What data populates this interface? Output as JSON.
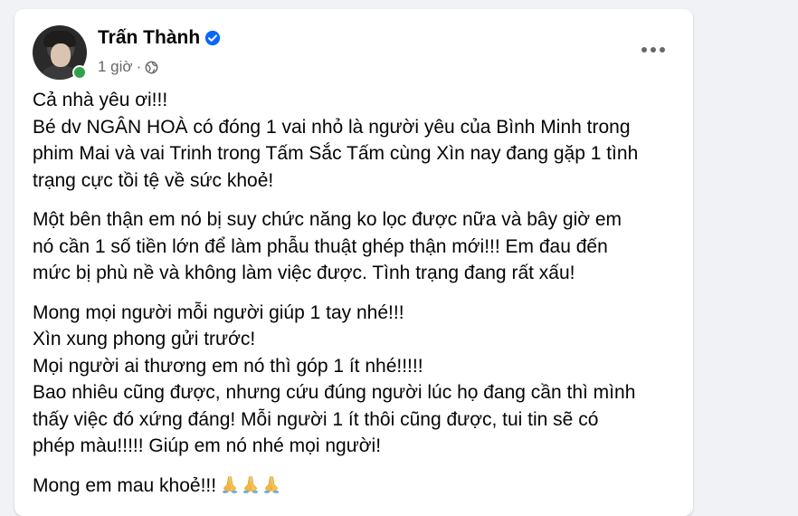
{
  "post": {
    "author": "Trấn Thành",
    "timestamp": "1 giờ",
    "separator": "·",
    "audience_icon": "globe-icon",
    "verified_icon": "verified-badge-icon",
    "more_icon": "more-options-icon",
    "paragraphs": [
      {
        "lines": [
          "Cả nhà yêu ơi!!!",
          "Bé dv NGÂN HOÀ có đóng 1 vai nhỏ là người yêu của Bình Minh trong",
          "phim Mai và vai Trinh trong Tấm Sắc Tấm cùng Xìn nay đang gặp 1 tình",
          "trạng cực tồi tệ về sức khoẻ!"
        ]
      },
      {
        "lines": [
          "Một bên thận em nó bị suy chức năng ko lọc được nữa và bây giờ em",
          "nó cần 1 số tiền lớn để làm phẫu thuật ghép thận mới!!! Em đau đến",
          "mức bị phù nề và không làm việc được. Tình trạng đang rất xấu!"
        ]
      },
      {
        "lines": [
          "Mong mọi người mỗi người giúp 1 tay nhé!!!",
          "Xìn xung phong gửi trước!",
          "Mọi người ai thương em nó thì góp 1 ít nhé!!!!!",
          "Bao nhiêu cũng được, nhưng cứu đúng người lúc họ đang cần thì mình",
          "thấy việc đó xứng đáng! Mỗi người 1 ít thôi cũng được, tui tin sẽ có",
          "phép màu!!!!! Giúp em nó nhé mọi người!"
        ]
      }
    ],
    "closing_line": "Mong em mau khoẻ!!!",
    "closing_emoji": "praying-hands-icon",
    "closing_emoji_count": 3
  },
  "colors": {
    "background": "#f0f2f5",
    "card": "#ffffff",
    "text": "#050505",
    "secondary_text": "#65676b",
    "verified": "#0866ff",
    "online": "#31a24c"
  }
}
